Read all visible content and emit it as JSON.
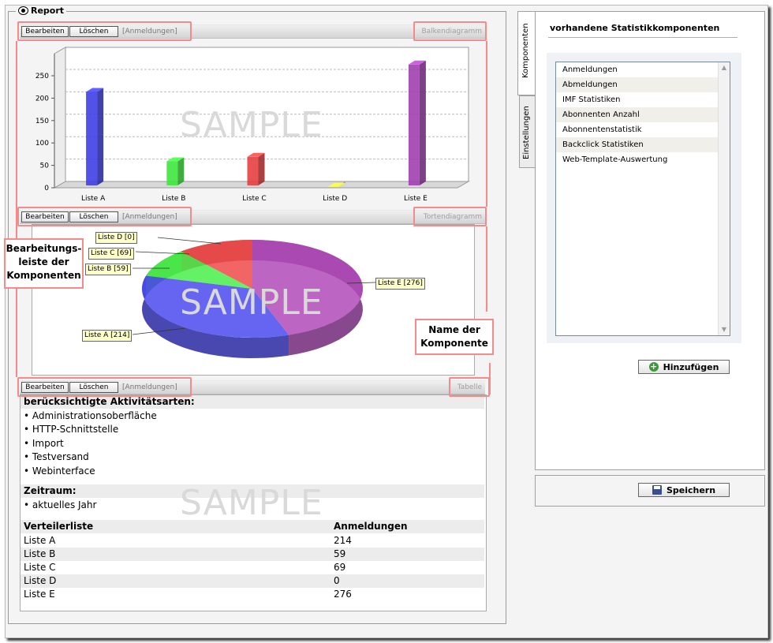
{
  "report": {
    "title": "Report"
  },
  "toolbar": {
    "edit": "Bearbeiten",
    "delete": "Löschen",
    "context": "[Anmeldungen]"
  },
  "components": {
    "bar": "Balkendiagramm",
    "pie": "Tortendiagramm",
    "table": "Tabelle"
  },
  "watermark": "SAMPLE",
  "callouts": {
    "bar_label_1": "Bearbeitungs-",
    "bar_label_2": "leiste der",
    "bar_label_3": "Komponenten",
    "name_label_1": "Name der",
    "name_label_2": "Komponente"
  },
  "chart_data": [
    {
      "type": "bar",
      "categories": [
        "Liste A",
        "Liste B",
        "Liste C",
        "Liste D",
        "Liste E"
      ],
      "values": [
        214,
        59,
        69,
        0,
        276
      ],
      "ylim": [
        0,
        250
      ],
      "yticks": [
        0,
        50,
        100,
        150,
        200,
        250
      ],
      "colors": [
        "#3f3fe6",
        "#3fe63f",
        "#e63f3f",
        "#e6e63f",
        "#a03fb0"
      ],
      "grid": true
    },
    {
      "type": "pie",
      "labels": [
        "Liste A [214]",
        "Liste B [59]",
        "Liste C [69]",
        "Liste D [0]",
        "Liste E [276]"
      ],
      "values": [
        214,
        59,
        69,
        0,
        276
      ],
      "colors": [
        "#4a4aee",
        "#4aee4a",
        "#ee4a4a",
        "#eeee4a",
        "#b04ab8"
      ]
    }
  ],
  "table": {
    "activity_header": "berücksichtigte Aktivitätsarten:",
    "activities": [
      "• Administrationsoberfläche",
      "• HTTP-Schnittstelle",
      "• Import",
      "• Testversand",
      "• Webinterface"
    ],
    "period_header": "Zeitraum:",
    "period_value": "• aktuelles Jahr",
    "col1": "Verteilerliste",
    "col2": "Anmeldungen",
    "rows": [
      {
        "name": "Liste A",
        "value": "214"
      },
      {
        "name": "Liste B",
        "value": "59"
      },
      {
        "name": "Liste C",
        "value": "69"
      },
      {
        "name": "Liste D",
        "value": "0"
      },
      {
        "name": "Liste E",
        "value": "276"
      }
    ]
  },
  "panel": {
    "tab_components": "Komponenten",
    "tab_settings": "Einstellungen",
    "title": "vorhandene Statistikkomponenten",
    "items": [
      "Anmeldungen",
      "Abmeldungen",
      "IMF Statistiken",
      "Abonnenten Anzahl",
      "Abonnentenstatistik",
      "Backclick Statistiken",
      "Web-Template-Auswertung"
    ],
    "add_button": "Hinzufügen",
    "save_button": "Speichern"
  }
}
